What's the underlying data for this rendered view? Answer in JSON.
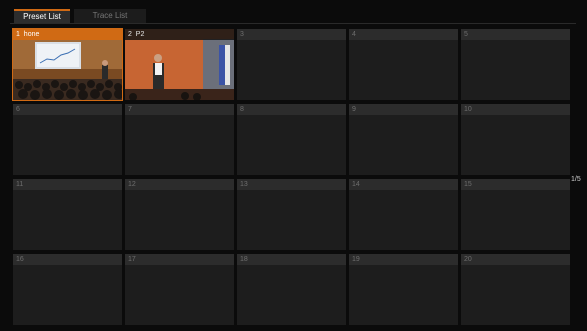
{
  "tabs": [
    {
      "label": "Preset List",
      "active": true
    },
    {
      "label": "Trace List",
      "active": false
    }
  ],
  "presets": [
    {
      "num": "1",
      "name": "hone",
      "thumb": "presentation-audience",
      "selected": true
    },
    {
      "num": "2",
      "name": "P2",
      "thumb": "speaker-stage",
      "selected": false
    },
    {
      "num": "3",
      "name": ""
    },
    {
      "num": "4",
      "name": ""
    },
    {
      "num": "5",
      "name": ""
    },
    {
      "num": "6",
      "name": ""
    },
    {
      "num": "7",
      "name": ""
    },
    {
      "num": "8",
      "name": ""
    },
    {
      "num": "9",
      "name": ""
    },
    {
      "num": "10",
      "name": ""
    },
    {
      "num": "11",
      "name": ""
    },
    {
      "num": "12",
      "name": ""
    },
    {
      "num": "13",
      "name": ""
    },
    {
      "num": "14",
      "name": ""
    },
    {
      "num": "15",
      "name": ""
    },
    {
      "num": "16",
      "name": ""
    },
    {
      "num": "17",
      "name": ""
    },
    {
      "num": "18",
      "name": ""
    },
    {
      "num": "19",
      "name": ""
    },
    {
      "num": "20",
      "name": ""
    }
  ],
  "page_indicator": "1/5",
  "colors": {
    "accent": "#d06a14",
    "background": "#0b0b0b",
    "cell": "#1d1d1d"
  }
}
